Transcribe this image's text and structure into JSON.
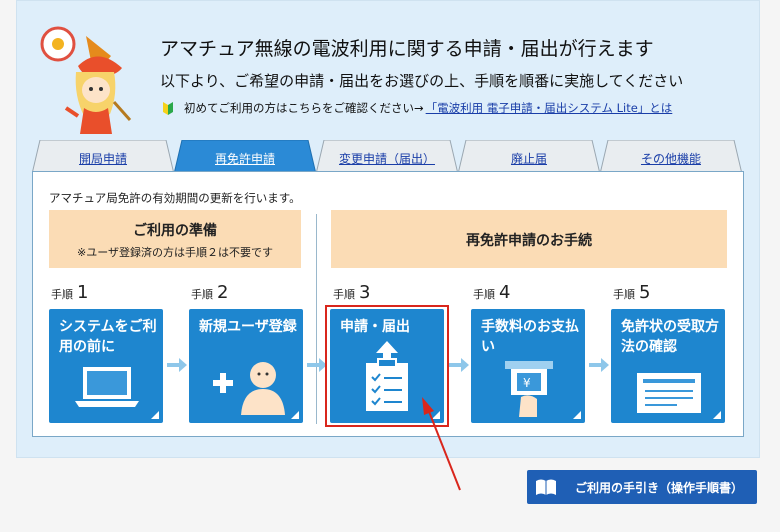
{
  "header": {
    "title": "アマチュア無線の電波利用に関する申請・届出が行えます",
    "subtitle": "以下より、ご希望の申請・届出をお選びの上、手順を順番に実施してください",
    "first_time_note": "初めてご利用の方はこちらをご確認ください→",
    "first_time_link": "「電波利用 電子申請・届出システム Lite」とは"
  },
  "tabs": [
    {
      "label": "開局申請",
      "active": false
    },
    {
      "label": "再免許申請",
      "active": true
    },
    {
      "label": "変更申請（届出）",
      "active": false
    },
    {
      "label": "廃止届",
      "active": false
    },
    {
      "label": "その他機能",
      "active": false
    }
  ],
  "panel": {
    "description": "アマチュア局免許の有効期間の更新を行います。",
    "prep_title": "ご利用の準備",
    "prep_note": "※ユーザ登録済の方は手順２は不要です",
    "procedure_title": "再免許申請のお手続"
  },
  "steps": [
    {
      "prefix": "手順",
      "number": "1",
      "title": "システムをご利用の前に",
      "icon": "laptop-icon"
    },
    {
      "prefix": "手順",
      "number": "2",
      "title": "新規ユーザ登録",
      "icon": "add-user-icon"
    },
    {
      "prefix": "手順",
      "number": "3",
      "title": "申請・届出",
      "icon": "clipboard-upload-icon"
    },
    {
      "prefix": "手順",
      "number": "4",
      "title": "手数料のお支払い",
      "icon": "atm-payment-icon"
    },
    {
      "prefix": "手順",
      "number": "5",
      "title": "免許状の受取方法の確認",
      "icon": "certificate-icon"
    }
  ],
  "guide_button": {
    "label": "ご利用の手引き（操作手順書）",
    "icon": "book-icon"
  },
  "colors": {
    "step_card": "#1e86cf",
    "tab_active": "#2b8ad6",
    "orange_box": "#fbdcb5",
    "highlight": "#d9261c",
    "guide_button": "#1f5fb5",
    "link": "#1a3ea8"
  }
}
